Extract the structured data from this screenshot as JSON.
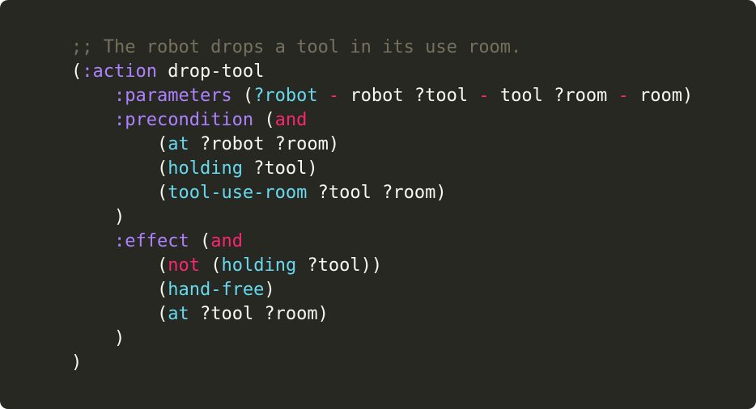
{
  "theme": {
    "background": "#272822",
    "colors": {
      "default": "#f8f8f2",
      "comment": "#75715e",
      "keyword": "#ae81ff",
      "function": "#66d9ef",
      "operator": "#f92672"
    }
  },
  "code": {
    "language": "pddl",
    "lines": [
      [
        {
          "t": ";; The robot drops a tool in its use room.",
          "c": "comment"
        }
      ],
      [
        {
          "t": "(",
          "c": "default"
        },
        {
          "t": ":action",
          "c": "keyword"
        },
        {
          "t": " drop-tool",
          "c": "default"
        }
      ],
      [
        {
          "t": "    ",
          "c": "default"
        },
        {
          "t": ":parameters",
          "c": "keyword"
        },
        {
          "t": " (",
          "c": "default"
        },
        {
          "t": "?robot",
          "c": "function"
        },
        {
          "t": " ",
          "c": "default"
        },
        {
          "t": "-",
          "c": "operator"
        },
        {
          "t": " robot ?tool ",
          "c": "default"
        },
        {
          "t": "-",
          "c": "operator"
        },
        {
          "t": " tool ?room ",
          "c": "default"
        },
        {
          "t": "-",
          "c": "operator"
        },
        {
          "t": " room)",
          "c": "default"
        }
      ],
      [
        {
          "t": "    ",
          "c": "default"
        },
        {
          "t": ":precondition",
          "c": "keyword"
        },
        {
          "t": " (",
          "c": "default"
        },
        {
          "t": "and",
          "c": "operator"
        }
      ],
      [
        {
          "t": "        (",
          "c": "default"
        },
        {
          "t": "at",
          "c": "function"
        },
        {
          "t": " ?robot ?room)",
          "c": "default"
        }
      ],
      [
        {
          "t": "        (",
          "c": "default"
        },
        {
          "t": "holding",
          "c": "function"
        },
        {
          "t": " ?tool)",
          "c": "default"
        }
      ],
      [
        {
          "t": "        (",
          "c": "default"
        },
        {
          "t": "tool-use-room",
          "c": "function"
        },
        {
          "t": " ?tool ?room)",
          "c": "default"
        }
      ],
      [
        {
          "t": "    )",
          "c": "default"
        }
      ],
      [
        {
          "t": "    ",
          "c": "default"
        },
        {
          "t": ":effect",
          "c": "keyword"
        },
        {
          "t": " (",
          "c": "default"
        },
        {
          "t": "and",
          "c": "operator"
        }
      ],
      [
        {
          "t": "        (",
          "c": "default"
        },
        {
          "t": "not",
          "c": "operator"
        },
        {
          "t": " (",
          "c": "default"
        },
        {
          "t": "holding",
          "c": "function"
        },
        {
          "t": " ?tool))",
          "c": "default"
        }
      ],
      [
        {
          "t": "        (",
          "c": "default"
        },
        {
          "t": "hand-free",
          "c": "function"
        },
        {
          "t": ")",
          "c": "default"
        }
      ],
      [
        {
          "t": "        (",
          "c": "default"
        },
        {
          "t": "at",
          "c": "function"
        },
        {
          "t": " ?tool ?room)",
          "c": "default"
        }
      ],
      [
        {
          "t": "    )",
          "c": "default"
        }
      ],
      [
        {
          "t": ")",
          "c": "default"
        }
      ]
    ]
  }
}
